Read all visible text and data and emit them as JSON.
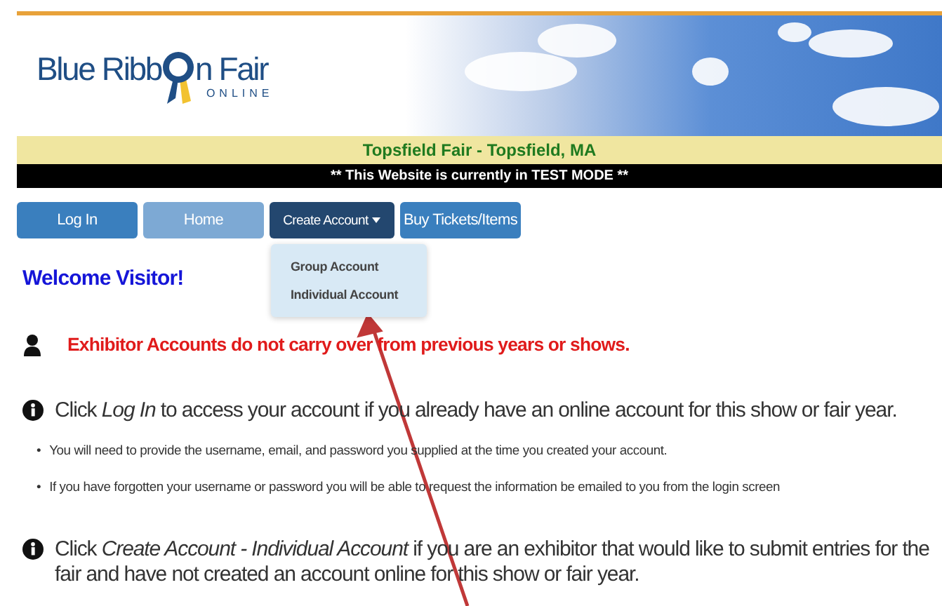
{
  "header": {
    "logo": {
      "title_start": "Blue Ribb",
      "title_end": "n Fair",
      "subtitle": "ONLINE"
    },
    "fair_name": "Topsfield Fair - Topsfield, MA",
    "notice": "** This Website is currently in TEST MODE **"
  },
  "nav": [
    {
      "label": "Log In",
      "kind": "normal",
      "open": false
    },
    {
      "label": "Home",
      "kind": "muted",
      "open": false
    },
    {
      "label": "Create Account",
      "kind": "normal",
      "open": true,
      "menu": [
        "Group Account",
        "Individual Account"
      ]
    },
    {
      "label": "Buy Tickets/Items",
      "kind": "normal",
      "open": false
    }
  ],
  "welcome": "Welcome Visitor!",
  "alert": {
    "text": "Exhibitor Accounts do not carry over from previous years or shows."
  },
  "sections": [
    {
      "text": "Click *Log In* to access your account if you already have an online account for this show or fair year.",
      "bullets": [
        {
          "marker": "•",
          "text": "You will need to provide the username, email, and password you supplied at the time you created your account."
        },
        {
          "marker": "•",
          "text": "If you have forgotten your username or password you will be able to request the information be emailed to you from the login screen"
        }
      ]
    },
    {
      "text": "Click *Create Account - Individual Account* if you are an exhibitor that would like to submit entries for the fair and have not created an account online for this show or fair year."
    }
  ]
}
